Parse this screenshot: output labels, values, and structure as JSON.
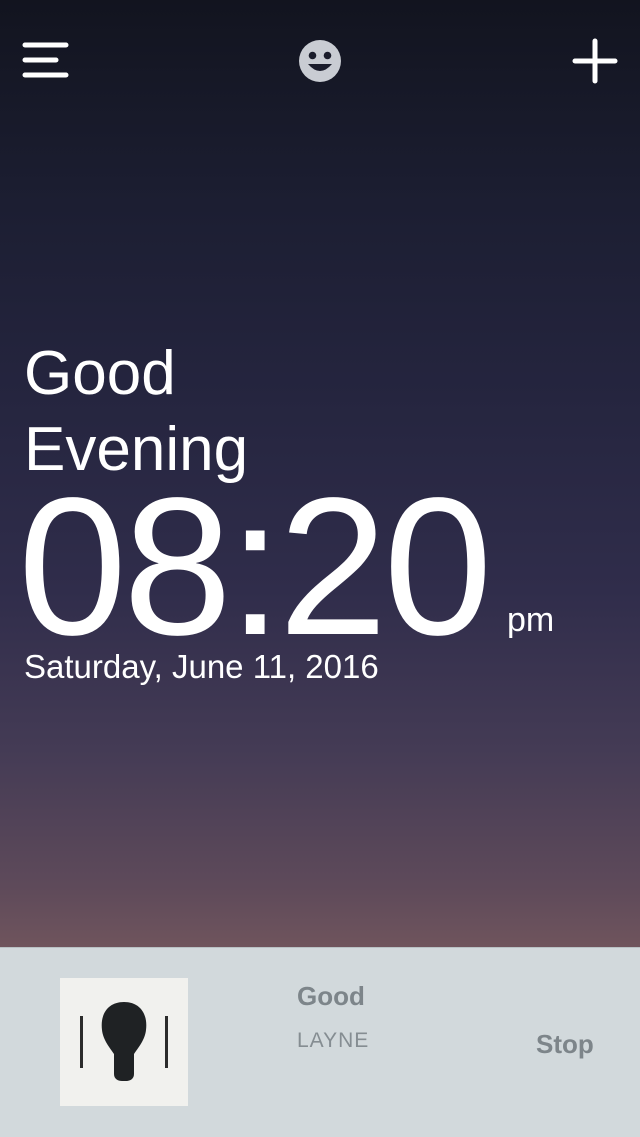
{
  "header": {
    "menu_icon": "hamburger-menu-icon",
    "center_icon": "smiley-face-icon",
    "add_icon": "plus-icon"
  },
  "greeting": {
    "line1": "Good",
    "line2": "Evening"
  },
  "clock": {
    "time": "08:20",
    "ampm": "pm"
  },
  "date": "Saturday, June 11, 2016",
  "now_playing": {
    "album_art_icon": "album-cover-icon",
    "title": "Good",
    "artist": "LAYNE",
    "stop_label": "Stop"
  },
  "colors": {
    "background_top": "#12141f",
    "background_bottom": "#a06e64",
    "player_bar": "#d2d9dc",
    "player_text": "#7d858a"
  }
}
